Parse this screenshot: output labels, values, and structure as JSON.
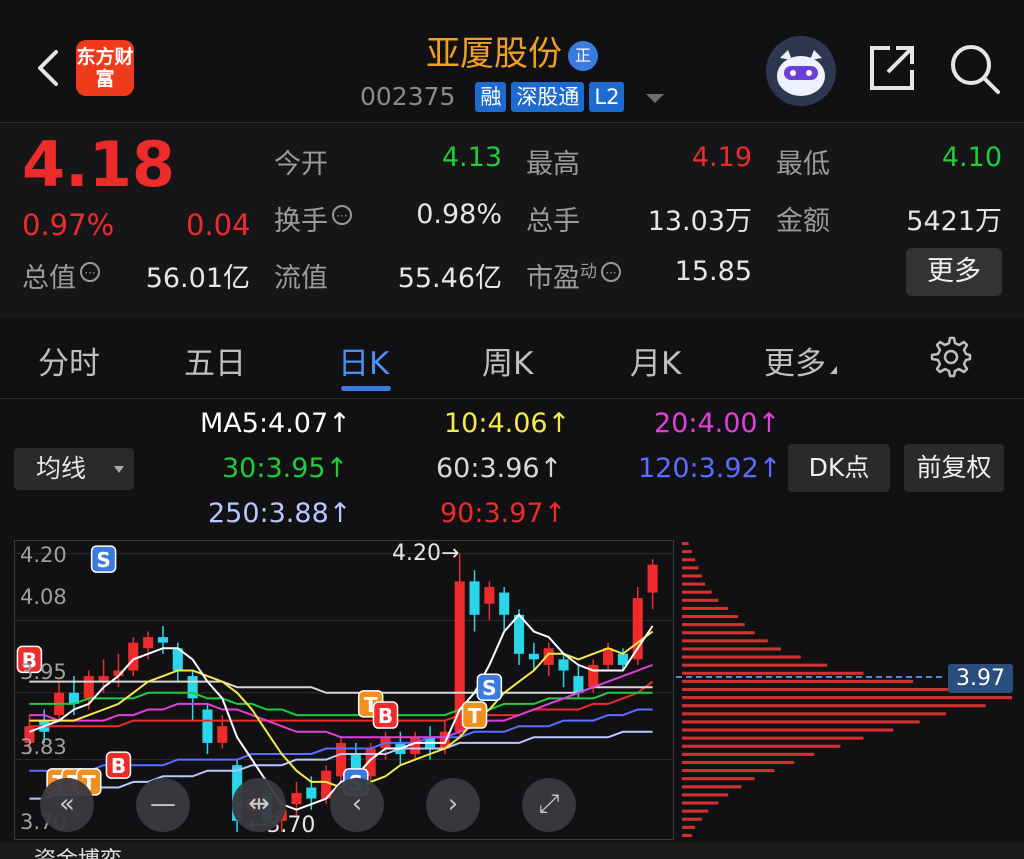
{
  "header": {
    "logo_text": "东方财富",
    "stock_name": "亚厦股份",
    "zheng_badge": "正",
    "code": "002375",
    "tags": [
      "融",
      "深股通",
      "L2"
    ]
  },
  "quote": {
    "price": "4.18",
    "change_pct": "0.97%",
    "change": "0.04",
    "open_label": "今开",
    "open": "4.13",
    "high_label": "最高",
    "high": "4.19",
    "low_label": "最低",
    "low": "4.10",
    "turnover_label": "换手",
    "turnover": "0.98%",
    "volume_label": "总手",
    "volume": "13.03万",
    "amount_label": "金额",
    "amount": "5421万",
    "mktcap_label": "总值",
    "mktcap": "56.01亿",
    "float_label": "流值",
    "float": "55.46亿",
    "pe_label": "市盈",
    "pe_sup": "动",
    "pe": "15.85",
    "more_button": "更多"
  },
  "tabs": [
    "分时",
    "五日",
    "日K",
    "周K",
    "月K",
    "更多"
  ],
  "active_tab": "日K",
  "ma": {
    "ma5": "MA5:4.07↑",
    "ma10": "10:4.06↑",
    "ma20": "20:4.00↑",
    "ma30": "30:3.95↑",
    "ma60": "60:3.96↑",
    "ma120": "120:3.92↑",
    "ma250": "250:3.88↑",
    "ma90": "90:3.97↑",
    "selector": "均线",
    "dk_button": "DK点",
    "fq_button": "前复权"
  },
  "colors": {
    "ma5": "#ffffff",
    "ma10": "#f5e94a",
    "ma20": "#e040d8",
    "ma30": "#1fcc3a",
    "ma60": "#d8d8d8",
    "ma120": "#5b6cff",
    "ma250": "#b8c8ff",
    "ma90": "#ee2b2b",
    "up": "#ee2b2b",
    "down": "#2ad6ea"
  },
  "chart_data": {
    "type": "candlestick",
    "y_ticks": [
      "4.20",
      "4.08",
      "3.95",
      "3.83",
      "3.70"
    ],
    "ylim": [
      3.7,
      4.22
    ],
    "high_mark": "4.20",
    "low_mark": "3.70",
    "volume_profile_label": "3.97",
    "candles": [
      {
        "o": 3.86,
        "c": 3.89,
        "h": 3.91,
        "l": 3.84
      },
      {
        "o": 3.9,
        "c": 3.88,
        "h": 3.92,
        "l": 3.86
      },
      {
        "o": 3.91,
        "c": 3.95,
        "h": 3.97,
        "l": 3.9
      },
      {
        "o": 3.95,
        "c": 3.93,
        "h": 3.98,
        "l": 3.91
      },
      {
        "o": 3.94,
        "c": 3.98,
        "h": 3.99,
        "l": 3.92
      },
      {
        "o": 3.97,
        "c": 3.98,
        "h": 4.01,
        "l": 3.95
      },
      {
        "o": 3.98,
        "c": 3.99,
        "h": 4.02,
        "l": 3.96
      },
      {
        "o": 3.99,
        "c": 4.04,
        "h": 4.05,
        "l": 3.98
      },
      {
        "o": 4.03,
        "c": 4.05,
        "h": 4.06,
        "l": 4.01
      },
      {
        "o": 4.05,
        "c": 4.04,
        "h": 4.07,
        "l": 4.02
      },
      {
        "o": 4.03,
        "c": 3.99,
        "h": 4.04,
        "l": 3.97
      },
      {
        "o": 3.98,
        "c": 3.94,
        "h": 3.99,
        "l": 3.9
      },
      {
        "o": 3.92,
        "c": 3.86,
        "h": 3.93,
        "l": 3.84
      },
      {
        "o": 3.86,
        "c": 3.89,
        "h": 3.91,
        "l": 3.85
      },
      {
        "o": 3.82,
        "c": 3.72,
        "h": 3.83,
        "l": 3.7
      },
      {
        "o": 3.74,
        "c": 3.76,
        "h": 3.78,
        "l": 3.72
      },
      {
        "o": 3.77,
        "c": 3.72,
        "h": 3.78,
        "l": 3.71
      },
      {
        "o": 3.72,
        "c": 3.74,
        "h": 3.76,
        "l": 3.7
      },
      {
        "o": 3.75,
        "c": 3.77,
        "h": 3.79,
        "l": 3.73
      },
      {
        "o": 3.78,
        "c": 3.76,
        "h": 3.8,
        "l": 3.74
      },
      {
        "o": 3.76,
        "c": 3.81,
        "h": 3.82,
        "l": 3.75
      },
      {
        "o": 3.8,
        "c": 3.86,
        "h": 3.87,
        "l": 3.79
      },
      {
        "o": 3.84,
        "c": 3.79,
        "h": 3.86,
        "l": 3.76
      },
      {
        "o": 3.8,
        "c": 3.85,
        "h": 3.86,
        "l": 3.78
      },
      {
        "o": 3.85,
        "c": 3.87,
        "h": 3.88,
        "l": 3.83
      },
      {
        "o": 3.86,
        "c": 3.84,
        "h": 3.88,
        "l": 3.82
      },
      {
        "o": 3.84,
        "c": 3.87,
        "h": 3.88,
        "l": 3.83
      },
      {
        "o": 3.87,
        "c": 3.85,
        "h": 3.89,
        "l": 3.83
      },
      {
        "o": 3.85,
        "c": 3.88,
        "h": 3.9,
        "l": 3.84
      },
      {
        "o": 3.88,
        "c": 4.15,
        "h": 4.2,
        "l": 3.87
      },
      {
        "o": 4.15,
        "c": 4.09,
        "h": 4.17,
        "l": 4.06
      },
      {
        "o": 4.11,
        "c": 4.14,
        "h": 4.15,
        "l": 4.08
      },
      {
        "o": 4.13,
        "c": 4.09,
        "h": 4.14,
        "l": 4.06
      },
      {
        "o": 4.09,
        "c": 4.02,
        "h": 4.1,
        "l": 4.0
      },
      {
        "o": 4.02,
        "c": 4.01,
        "h": 4.04,
        "l": 3.99
      },
      {
        "o": 4.0,
        "c": 4.03,
        "h": 4.04,
        "l": 3.98
      },
      {
        "o": 4.01,
        "c": 3.99,
        "h": 4.02,
        "l": 3.96
      },
      {
        "o": 3.98,
        "c": 3.95,
        "h": 4.0,
        "l": 3.94
      },
      {
        "o": 3.96,
        "c": 4.0,
        "h": 4.01,
        "l": 3.95
      },
      {
        "o": 4.0,
        "c": 4.03,
        "h": 4.04,
        "l": 3.99
      },
      {
        "o": 4.02,
        "c": 4.0,
        "h": 4.03,
        "l": 3.99
      },
      {
        "o": 4.01,
        "c": 4.12,
        "h": 4.14,
        "l": 4.0
      },
      {
        "o": 4.13,
        "c": 4.18,
        "h": 4.19,
        "l": 4.1
      }
    ],
    "ma_lines": {
      "ma5": [
        3.88,
        3.89,
        3.9,
        3.92,
        3.93,
        3.96,
        3.98,
        4.01,
        4.02,
        4.03,
        4.03,
        4.01,
        3.97,
        3.94,
        3.87,
        3.83,
        3.79,
        3.75,
        3.74,
        3.75,
        3.76,
        3.79,
        3.8,
        3.83,
        3.85,
        3.85,
        3.86,
        3.86,
        3.86,
        3.92,
        3.95,
        4.0,
        4.06,
        4.09,
        4.06,
        4.05,
        4.02,
        4.0,
        3.99,
        3.99,
        3.99,
        4.03,
        4.07
      ],
      "ma10": [
        3.9,
        3.9,
        3.9,
        3.9,
        3.91,
        3.92,
        3.93,
        3.95,
        3.97,
        3.98,
        3.99,
        3.99,
        3.98,
        3.97,
        3.95,
        3.92,
        3.88,
        3.84,
        3.81,
        3.79,
        3.79,
        3.78,
        3.78,
        3.79,
        3.8,
        3.82,
        3.83,
        3.84,
        3.85,
        3.87,
        3.9,
        3.92,
        3.95,
        3.97,
        3.99,
        4.02,
        4.02,
        4.01,
        4.02,
        4.03,
        4.02,
        4.04,
        4.06
      ],
      "ma20": [
        3.91,
        3.91,
        3.9,
        3.9,
        3.9,
        3.9,
        3.91,
        3.91,
        3.92,
        3.92,
        3.93,
        3.93,
        3.93,
        3.92,
        3.92,
        3.91,
        3.9,
        3.89,
        3.88,
        3.88,
        3.88,
        3.87,
        3.87,
        3.87,
        3.87,
        3.87,
        3.87,
        3.87,
        3.87,
        3.88,
        3.89,
        3.9,
        3.9,
        3.91,
        3.92,
        3.93,
        3.94,
        3.95,
        3.96,
        3.97,
        3.98,
        3.99,
        4.0
      ],
      "ma30": [
        3.93,
        3.93,
        3.93,
        3.93,
        3.94,
        3.94,
        3.94,
        3.94,
        3.95,
        3.95,
        3.95,
        3.95,
        3.94,
        3.94,
        3.93,
        3.93,
        3.92,
        3.92,
        3.91,
        3.91,
        3.91,
        3.91,
        3.91,
        3.91,
        3.91,
        3.91,
        3.91,
        3.91,
        3.91,
        3.92,
        3.92,
        3.92,
        3.93,
        3.93,
        3.93,
        3.94,
        3.94,
        3.94,
        3.94,
        3.95,
        3.95,
        3.95,
        3.95
      ],
      "ma60": [
        3.97,
        3.97,
        3.97,
        3.97,
        3.97,
        3.97,
        3.97,
        3.97,
        3.97,
        3.97,
        3.97,
        3.97,
        3.97,
        3.97,
        3.96,
        3.96,
        3.96,
        3.96,
        3.96,
        3.96,
        3.95,
        3.95,
        3.95,
        3.95,
        3.95,
        3.95,
        3.95,
        3.95,
        3.95,
        3.95,
        3.95,
        3.95,
        3.95,
        3.95,
        3.95,
        3.95,
        3.95,
        3.95,
        3.96,
        3.96,
        3.96,
        3.96,
        3.96
      ],
      "ma120": [
        3.81,
        3.81,
        3.81,
        3.81,
        3.81,
        3.82,
        3.82,
        3.82,
        3.82,
        3.82,
        3.83,
        3.83,
        3.83,
        3.83,
        3.83,
        3.84,
        3.84,
        3.84,
        3.84,
        3.84,
        3.85,
        3.85,
        3.85,
        3.85,
        3.86,
        3.86,
        3.86,
        3.87,
        3.87,
        3.87,
        3.88,
        3.88,
        3.88,
        3.89,
        3.89,
        3.89,
        3.9,
        3.9,
        3.9,
        3.91,
        3.91,
        3.92,
        3.92
      ],
      "ma250": [
        3.76,
        3.76,
        3.77,
        3.77,
        3.78,
        3.78,
        3.78,
        3.79,
        3.79,
        3.8,
        3.8,
        3.8,
        3.81,
        3.81,
        3.81,
        3.82,
        3.82,
        3.82,
        3.83,
        3.83,
        3.83,
        3.84,
        3.84,
        3.84,
        3.84,
        3.85,
        3.85,
        3.85,
        3.85,
        3.86,
        3.86,
        3.86,
        3.86,
        3.86,
        3.87,
        3.87,
        3.87,
        3.87,
        3.87,
        3.87,
        3.88,
        3.88,
        3.88
      ],
      "ma90": [
        3.89,
        3.89,
        3.89,
        3.89,
        3.89,
        3.89,
        3.89,
        3.9,
        3.9,
        3.9,
        3.9,
        3.9,
        3.9,
        3.9,
        3.9,
        3.9,
        3.9,
        3.9,
        3.9,
        3.9,
        3.9,
        3.9,
        3.9,
        3.9,
        3.9,
        3.9,
        3.9,
        3.9,
        3.9,
        3.91,
        3.91,
        3.91,
        3.91,
        3.91,
        3.92,
        3.92,
        3.92,
        3.92,
        3.93,
        3.93,
        3.94,
        3.95,
        3.97
      ]
    },
    "volume_profile": [
      2,
      3,
      4,
      5,
      6,
      7,
      9,
      11,
      14,
      17,
      19,
      22,
      26,
      30,
      36,
      44,
      55,
      70,
      85,
      100,
      92,
      80,
      72,
      64,
      55,
      48,
      40,
      34,
      28,
      22,
      18,
      14,
      11,
      8,
      6,
      4,
      3
    ]
  },
  "markers": [
    {
      "label": "S",
      "i": 5,
      "y": 4.19,
      "color": "#3b7be0"
    },
    {
      "label": "B",
      "i": 0,
      "y": 4.01,
      "color": "#ee2b2b"
    },
    {
      "label": "B",
      "i": 6,
      "y": 3.82,
      "color": "#ee2b2b"
    },
    {
      "label": "T",
      "i": 2,
      "y": 3.79,
      "color": "#f09020"
    },
    {
      "label": "T",
      "i": 3,
      "y": 3.79,
      "color": "#f09020"
    },
    {
      "label": "T",
      "i": 4,
      "y": 3.79,
      "color": "#f09020"
    },
    {
      "label": "S",
      "i": 22,
      "y": 3.79,
      "color": "#3b7be0"
    },
    {
      "label": "T",
      "i": 23,
      "y": 3.93,
      "color": "#f09020"
    },
    {
      "label": "B",
      "i": 24,
      "y": 3.91,
      "color": "#ee2b2b"
    },
    {
      "label": "S",
      "i": 31,
      "y": 3.96,
      "color": "#3b7be0"
    },
    {
      "label": "T",
      "i": 30,
      "y": 3.91,
      "color": "#f09020"
    }
  ],
  "controls": [
    "«",
    "—",
    "⇹",
    "‹",
    "›",
    "⤢"
  ],
  "footer_text": "资金博弈"
}
